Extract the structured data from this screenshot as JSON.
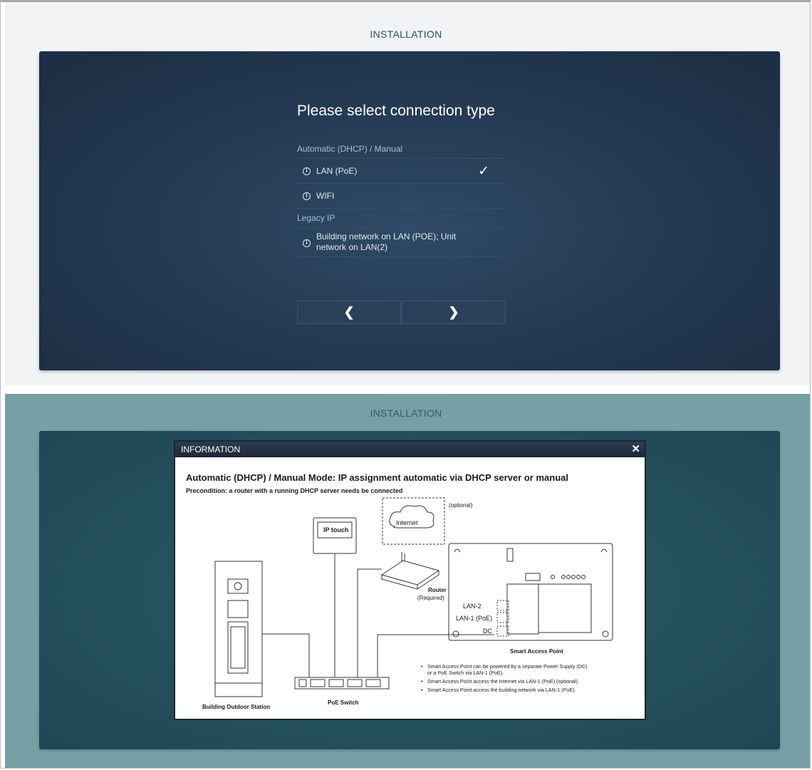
{
  "top_screen": {
    "title": "INSTALLATION",
    "heading": "Please select connection type",
    "section_auto": "Automatic (DHCP) / Manual",
    "options_auto": [
      {
        "label": "LAN (PoE)",
        "selected": true
      },
      {
        "label": "WIFI",
        "selected": false
      }
    ],
    "section_legacy": "Legacy IP",
    "option_legacy": {
      "line1": "Building network on LAN (POE); Unit",
      "line2": "network on LAN(2)"
    },
    "check_glyph": "✓",
    "back_glyph": "❮",
    "next_glyph": "❯"
  },
  "bottom_screen": {
    "title": "INSTALLATION",
    "dialog": {
      "header": "INFORMATION",
      "close_glyph": "✕",
      "title": "Automatic (DHCP) / Manual Mode: IP assignment automatic via DHCP server or manual",
      "subtitle": "Precondition: a router with a running DHCP server needs be connected",
      "diagram": {
        "internet": "Internet",
        "optional": "(optional)",
        "ip_touch": "IP touch",
        "router": "Router",
        "router_required": "(Required)",
        "lan2": "LAN-2",
        "lan1": "LAN-1 (PoE)",
        "dc": "DC",
        "poe_switch": "PoE Switch",
        "outdoor_station": "Building Outdoor Station",
        "smart_access_point": "Smart Access Point",
        "notes": [
          {
            "line1": "Smart Access Point can be powered by a separate Power Supply (DC)",
            "line2": "or a PoE Switch via LAN-1 (PoE)."
          },
          {
            "line1": "Smart Access Point access the Internet via LAN-1 (PoE) (optional).",
            "line2": ""
          },
          {
            "line1": "Smart Access Point access the building network via LAN-1 (PoE).",
            "line2": ""
          }
        ]
      }
    }
  },
  "colors": {
    "top_panel": "#233850",
    "bottom_panel": "#244f5d",
    "bottom_bg": "#77a0a6",
    "dialog_header": "#1d2839"
  }
}
